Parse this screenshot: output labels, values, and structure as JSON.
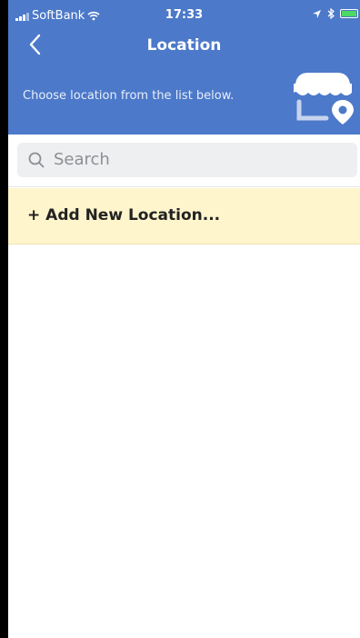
{
  "status_bar": {
    "carrier": "SoftBank",
    "time": "17:33"
  },
  "header": {
    "title": "Location",
    "subtitle": "Choose location from the list below."
  },
  "search": {
    "placeholder": "Search"
  },
  "list": {
    "add_new_label": "+ Add New Location..."
  },
  "colors": {
    "header_bg": "#4C79C9",
    "add_row_bg": "#FFF5CC",
    "search_bg": "#EEEFF1"
  },
  "icons": [
    "back-chevron-icon",
    "store-location-icon",
    "search-icon",
    "wifi-icon",
    "location-arrow-icon",
    "bluetooth-icon",
    "battery-icon"
  ]
}
